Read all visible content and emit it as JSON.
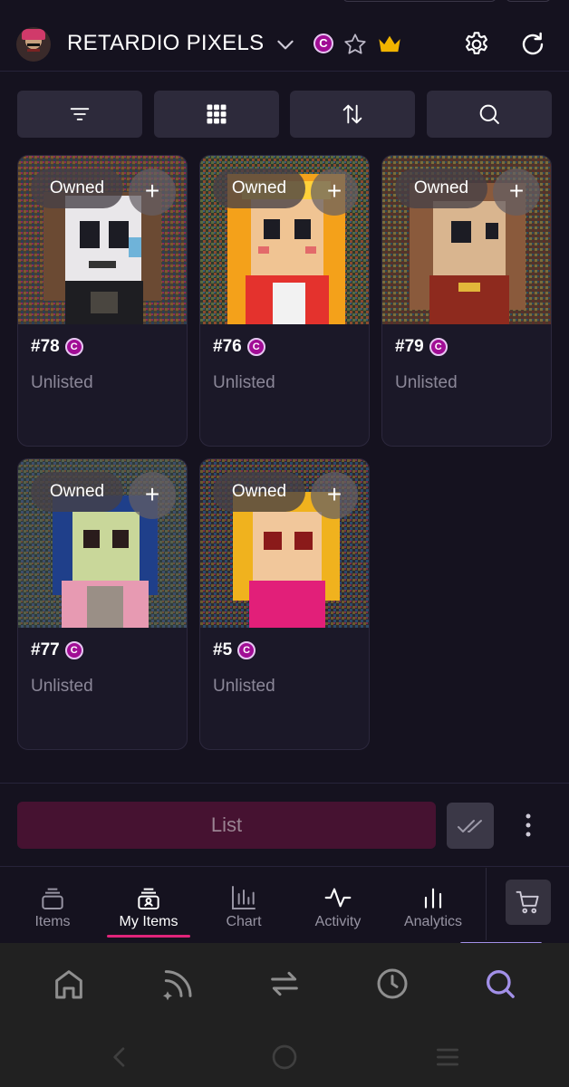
{
  "header": {
    "collection_title": "RETARDIO PIXELS",
    "chain_badge": "C"
  },
  "toolbar": {
    "buttons": [
      "filter-icon",
      "grid-icon",
      "sort-icon",
      "search-icon"
    ]
  },
  "items": [
    {
      "number": "#78",
      "badge": "C",
      "owned_label": "Owned",
      "add_label": "+",
      "status": "Unlisted"
    },
    {
      "number": "#76",
      "badge": "C",
      "owned_label": "Owned",
      "add_label": "+",
      "status": "Unlisted"
    },
    {
      "number": "#79",
      "badge": "C",
      "owned_label": "Owned",
      "add_label": "+",
      "status": "Unlisted"
    },
    {
      "number": "#77",
      "badge": "C",
      "owned_label": "Owned",
      "add_label": "+",
      "status": "Unlisted"
    },
    {
      "number": "#5",
      "badge": "C",
      "owned_label": "Owned",
      "add_label": "+",
      "status": "Unlisted"
    }
  ],
  "actions": {
    "list_label": "List"
  },
  "tabs": [
    {
      "label": "Items",
      "icon": "stack-icon"
    },
    {
      "label": "My Items",
      "icon": "user-stack-icon",
      "active": true
    },
    {
      "label": "Chart",
      "icon": "bar-chart-icon"
    },
    {
      "label": "Activity",
      "icon": "activity-icon"
    },
    {
      "label": "Analytics",
      "icon": "analytics-icon"
    }
  ],
  "colors": {
    "background": "#15121f",
    "card": "#1b1828",
    "accent_pink": "#e0247a",
    "list_button": "#461231",
    "badge_purple": "#a10d95",
    "nav_active": "#a290e8"
  },
  "app_nav": [
    "home-icon",
    "feed-icon",
    "swap-icon",
    "history-icon",
    "search-icon"
  ],
  "system_nav": [
    "back-icon",
    "home-circle-icon",
    "recents-icon"
  ]
}
